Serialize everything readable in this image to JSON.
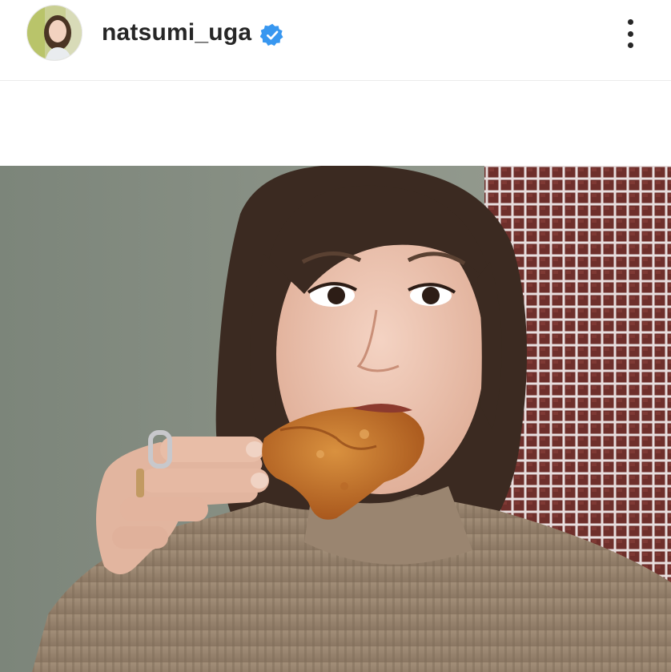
{
  "post": {
    "username": "natsumi_uga",
    "verified": true,
    "avatar_icon": "profile-avatar",
    "verified_icon": "verified-badge-icon",
    "more_icon": "more-options-icon",
    "colors": {
      "verified_blue": "#3897f0",
      "text": "#262626",
      "divider": "#ececec"
    }
  }
}
